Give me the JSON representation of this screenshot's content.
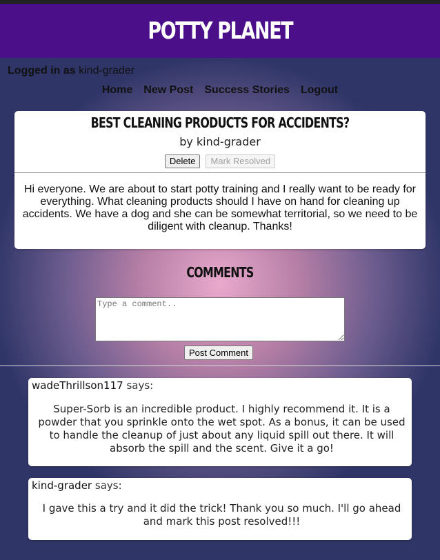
{
  "app": {
    "title": "POTTY PLANET"
  },
  "session": {
    "prefix": "Logged in as",
    "username": "kind-grader"
  },
  "nav": {
    "home": "Home",
    "new_post": "New Post",
    "success": "Success Stories",
    "logout": "Logout"
  },
  "post": {
    "title": "BEST CLEANING PRODUCTS FOR ACCIDENTS?",
    "by_label": "by",
    "author": "kind-grader",
    "delete_label": "Delete",
    "resolve_label": "Mark Resolved",
    "body": "Hi everyone. We are about to start potty training and I really want to be ready for everything. What cleaning products should I have on hand for cleaning up accidents. We have a dog and she can be somewhat territorial, so we need to be diligent with cleanup. Thanks!"
  },
  "comments_section": {
    "heading": "COMMENTS",
    "placeholder": "Type a comment..",
    "post_label": "Post Comment",
    "says_label": "says:",
    "items": [
      {
        "author": "wadeThrillson117",
        "text": "Super-Sorb is an incredible product. I highly recommend it. It is a powder that you sprinkle onto the wet spot. As a bonus, it can be used to handle the cleanup of just about any liquid spill out there. It will absorb the spill and the scent. Give it a go!"
      },
      {
        "author": "kind-grader",
        "text": "I gave this a try and it did the trick! Thank you so much. I'll go ahead and mark this post resolved!!!"
      }
    ]
  },
  "colors": {
    "header_bg": "#4b0f8a",
    "card_bg": "#ffffff",
    "title_text": "#ffffff"
  }
}
